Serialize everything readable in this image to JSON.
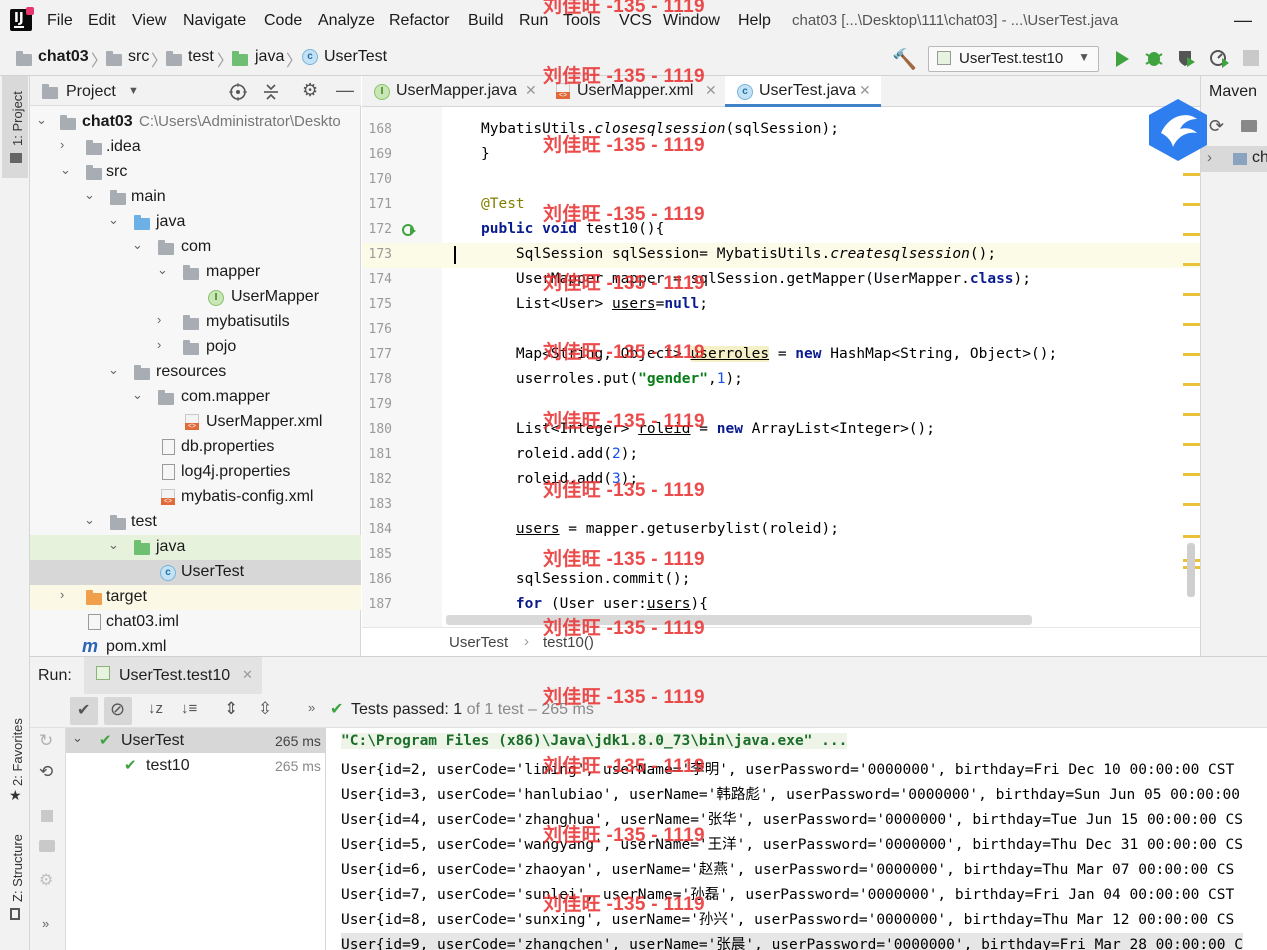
{
  "menubar": {
    "items": [
      "File",
      "Edit",
      "View",
      "Navigate",
      "Code",
      "Analyze",
      "Refactor",
      "Build",
      "Run",
      "Tools",
      "VCS",
      "Window",
      "Help"
    ],
    "window_title": "chat03 [...\\Desktop\\111\\chat03] - ...\\UserTest.java"
  },
  "navbar": {
    "breadcrumbs": [
      "chat03",
      "src",
      "test",
      "java",
      "UserTest"
    ],
    "run_config": "UserTest.test10"
  },
  "sidebar": {
    "project_tab": "1: Project",
    "favorites_tab": "2: Favorites",
    "structure_tab": "Z: Structure"
  },
  "project": {
    "header": "Project",
    "root_path": "C:\\Users\\Administrator\\Deskto",
    "tree": [
      "chat03",
      ".idea",
      "src",
      "main",
      "java",
      "com",
      "mapper",
      "UserMapper",
      "mybatisutils",
      "pojo",
      "resources",
      "com.mapper",
      "UserMapper.xml",
      "db.properties",
      "log4j.properties",
      "mybatis-config.xml",
      "test",
      "java",
      "UserTest",
      "target",
      "chat03.iml",
      "pom.xml"
    ]
  },
  "editor": {
    "tabs": [
      "UserMapper.java",
      "UserMapper.xml",
      "UserTest.java"
    ],
    "active_tab": "UserTest.java",
    "breadcrumb": [
      "UserTest",
      "test10()"
    ]
  },
  "maven": {
    "title": "Maven",
    "item": "ch"
  },
  "run": {
    "label": "Run:",
    "tab": "UserTest.test10",
    "status_prefix": "Tests passed:",
    "status_count": "1",
    "status_rest": "of 1 test – 265 ms",
    "tree": [
      {
        "name": "UserTest",
        "time": "265 ms"
      },
      {
        "name": "test10",
        "time": "265 ms"
      }
    ],
    "console": [
      "\"C:\\Program Files (x86)\\Java\\jdk1.8.0_73\\bin\\java.exe\" ...",
      "User{id=2, userCode='liming', userName='李明', userPassword='0000000', birthday=Fri Dec 10 00:00:00 CST",
      "User{id=3, userCode='hanlubiao', userName='韩路彪', userPassword='0000000', birthday=Sun Jun 05 00:00:00",
      "User{id=4, userCode='zhanghua', userName='张华', userPassword='0000000', birthday=Tue Jun 15 00:00:00 CS",
      "User{id=5, userCode='wangyang', userName='王洋', userPassword='0000000', birthday=Thu Dec 31 00:00:00 CS",
      "User{id=6, userCode='zhaoyan', userName='赵燕', userPassword='0000000', birthday=Thu Mar 07 00:00:00 CS",
      "User{id=7, userCode='sunlei', userName='孙磊', userPassword='0000000', birthday=Fri Jan 04 00:00:00 CST",
      "User{id=8, userCode='sunxing', userName='孙兴', userPassword='0000000', birthday=Thu Mar 12 00:00:00 CS",
      "User{id=9, userCode='zhangchen', userName='张晨', userPassword='0000000', birthday=Fri Mar 28 00:00:00 C"
    ]
  },
  "watermark": "刘佳旺 -135 - 1119"
}
